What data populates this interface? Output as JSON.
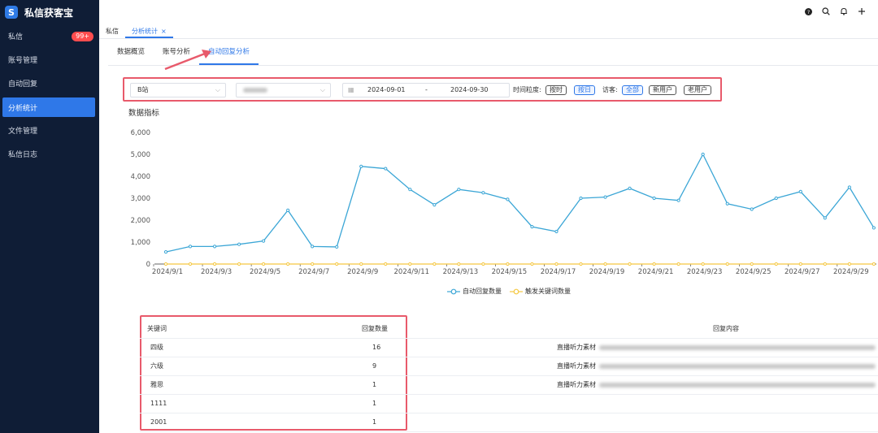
{
  "sidebar": {
    "app_name": "私信获客宝",
    "items": [
      {
        "label": "私信",
        "badge": "99+"
      },
      {
        "label": "账号管理"
      },
      {
        "label": "自动回复"
      },
      {
        "label": "分析统计",
        "active": true
      },
      {
        "label": "文件管理"
      },
      {
        "label": "私信日志"
      }
    ]
  },
  "topbar": {
    "icons": [
      "help-icon",
      "search-icon",
      "bell-icon",
      "add-icon"
    ]
  },
  "tabs": [
    {
      "label": "私信"
    },
    {
      "label": "分析统计",
      "active": true,
      "close": "×"
    }
  ],
  "subtabs": [
    {
      "label": "数据概览"
    },
    {
      "label": "账号分析"
    },
    {
      "label": "自动回复分析",
      "active": true
    }
  ],
  "filters": {
    "platform": "B站",
    "start_date": "2024-09-01",
    "date_sep": "-",
    "end_date": "2024-09-30",
    "granularity_label": "时间粒度:",
    "granularity_options": [
      "按时",
      "按日"
    ],
    "granularity_selected": "按日",
    "visitor_label": "访客:",
    "visitor_options": [
      "全部",
      "新用户",
      "老用户"
    ],
    "visitor_selected": "全部"
  },
  "chart_title": "数据指标",
  "chart_data": {
    "type": "line",
    "x": [
      "2024/9/1",
      "2024/9/2",
      "2024/9/3",
      "2024/9/4",
      "2024/9/5",
      "2024/9/6",
      "2024/9/7",
      "2024/9/8",
      "2024/9/9",
      "2024/9/10",
      "2024/9/11",
      "2024/9/12",
      "2024/9/13",
      "2024/9/14",
      "2024/9/15",
      "2024/9/16",
      "2024/9/17",
      "2024/9/18",
      "2024/9/19",
      "2024/9/20",
      "2024/9/21",
      "2024/9/22",
      "2024/9/23",
      "2024/9/24",
      "2024/9/25",
      "2024/9/26",
      "2024/9/27",
      "2024/9/28",
      "2024/9/29",
      "2024/9/30"
    ],
    "x_tick_labels": [
      "2024/9/1",
      "2024/9/3",
      "2024/9/5",
      "2024/9/7",
      "2024/9/9",
      "2024/9/11",
      "2024/9/13",
      "2024/9/15",
      "2024/9/17",
      "2024/9/19",
      "2024/9/21",
      "2024/9/23",
      "2024/9/25",
      "2024/9/27",
      "2024/9/29"
    ],
    "y_ticks": [
      "0",
      "1,000",
      "2,000",
      "3,000",
      "4,000",
      "5,000",
      "6,000"
    ],
    "ylim": [
      0,
      6000
    ],
    "series": [
      {
        "name": "自动回复数量",
        "color": "#3ba6d6",
        "values": [
          550,
          800,
          800,
          900,
          1050,
          2450,
          800,
          780,
          4450,
          4350,
          3400,
          2700,
          3400,
          3250,
          2950,
          1700,
          1480,
          3000,
          3050,
          3450,
          3000,
          2900,
          5000,
          2750,
          2500,
          3000,
          3300,
          2100,
          3500,
          1650
        ]
      },
      {
        "name": "触发关键词数量",
        "color": "#f5c842",
        "values": [
          0,
          0,
          0,
          0,
          0,
          0,
          0,
          0,
          0,
          0,
          0,
          0,
          0,
          0,
          0,
          0,
          0,
          0,
          0,
          0,
          0,
          0,
          0,
          0,
          0,
          0,
          0,
          0,
          0,
          0
        ]
      }
    ],
    "legend": "bottom"
  },
  "table": {
    "headers": [
      "关键词",
      "回复数量",
      "回复内容"
    ],
    "rows": [
      {
        "keyword": "四级",
        "count": "16",
        "content": "直播听力素材"
      },
      {
        "keyword": "六级",
        "count": "9",
        "content": "直播听力素材"
      },
      {
        "keyword": "雅思",
        "count": "1",
        "content": "直播听力素材"
      },
      {
        "keyword": "1111",
        "count": "1",
        "content": ""
      },
      {
        "keyword": "2001",
        "count": "1",
        "content": ""
      }
    ]
  },
  "colors": {
    "accent": "#2f78e8",
    "sidebar_bg": "#0f1d36",
    "annotation": "#e85a6b"
  }
}
